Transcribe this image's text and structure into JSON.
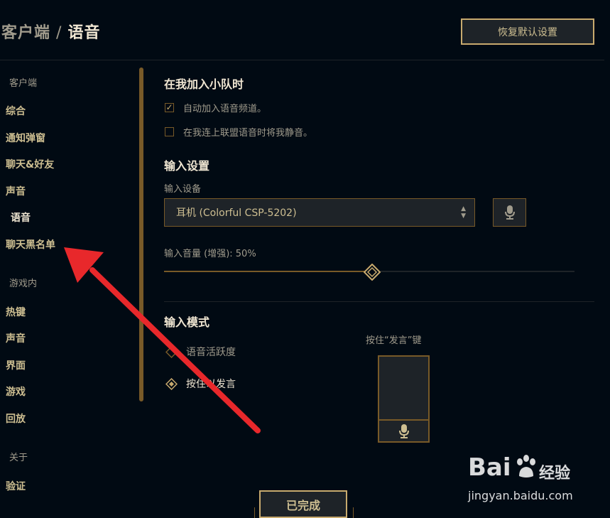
{
  "header": {
    "breadcrumb_parent": "客户端",
    "separator": "/",
    "current": "语音",
    "restore_label": "恢复默认设置"
  },
  "sidebar": {
    "section_client": "客户端",
    "client_items": [
      "综合",
      "通知弹窗",
      "聊天&好友",
      "声音",
      "语音",
      "聊天黑名单"
    ],
    "active_item": "语音",
    "section_ingame": "游戏内",
    "ingame_items": [
      "热键",
      "声音",
      "界面",
      "游戏",
      "回放"
    ],
    "section_about": "关于",
    "about_items": [
      "验证"
    ]
  },
  "party": {
    "title": "在我加入小队时",
    "auto_join_label": "自动加入语音频道。",
    "auto_join_checked": true,
    "mute_label": "在我连上联盟语音时将我静音。",
    "mute_checked": false
  },
  "input_settings": {
    "title": "输入设置",
    "device_label": "输入设备",
    "device_value": "耳机 (Colorful CSP-5202)",
    "volume_label": "输入音量 (增强): 50%",
    "volume_fraction": 0.5
  },
  "input_mode": {
    "title": "输入模式",
    "options": [
      "语音活跃度",
      "按住以发言"
    ],
    "selected": "按住以发言",
    "ptt_label": "按住“发言”键"
  },
  "footer": {
    "done_label": "已完成"
  },
  "watermark": {
    "brand": "Bai",
    "brand_suffix": "经验",
    "url": "jingyan.baidu.com"
  },
  "colors": {
    "background": "#010a13",
    "gold": "#c8aa6e",
    "gold_dark": "#785a28",
    "text": "#f0e6d2",
    "annotation_arrow": "#e8282b"
  },
  "icons": [
    "checkmark-icon",
    "chevron-updown-icon",
    "microphone-icon",
    "diamond-thumb-icon",
    "diamond-radio-icon",
    "paw-icon",
    "red-arrow-annotation"
  ]
}
